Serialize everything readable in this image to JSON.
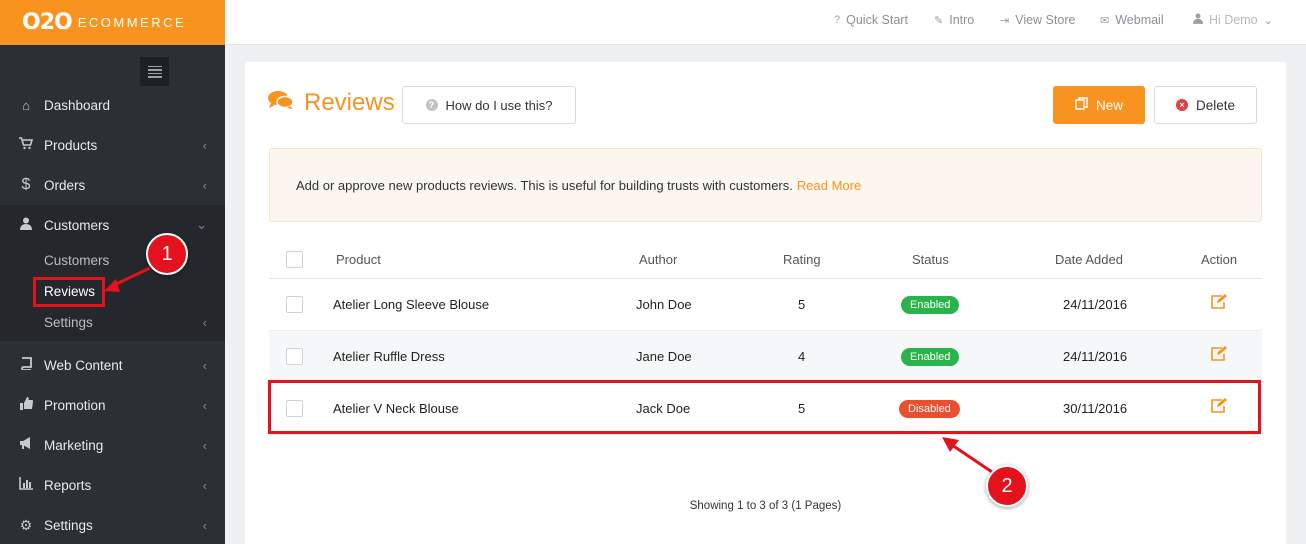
{
  "logo": {
    "mark": "O2O",
    "text": "ECOMMERCE"
  },
  "topbar": {
    "links": [
      {
        "label": "Quick Start",
        "icon": "question-icon"
      },
      {
        "label": "Intro",
        "icon": "magic-wand-icon"
      },
      {
        "label": "View Store",
        "icon": "sign-in-icon"
      },
      {
        "label": "Webmail",
        "icon": "envelope-icon"
      }
    ],
    "user_label": "Hi Demo"
  },
  "sidebar": {
    "items": [
      {
        "label": "Dashboard"
      },
      {
        "label": "Products"
      },
      {
        "label": "Orders"
      },
      {
        "label": "Customers"
      },
      {
        "label": "Web Content"
      },
      {
        "label": "Promotion"
      },
      {
        "label": "Marketing"
      },
      {
        "label": "Reports"
      },
      {
        "label": "Settings"
      }
    ],
    "sub_items": [
      {
        "label": "Customers"
      },
      {
        "label": "Reviews"
      },
      {
        "label": "Settings"
      }
    ]
  },
  "page": {
    "title": "Reviews",
    "help_label": "How do I use this?",
    "new_label": "New",
    "delete_label": "Delete",
    "notice_text": "Add or approve new products reviews. This is useful for building trusts with customers.",
    "notice_link": "Read More"
  },
  "table": {
    "headers": [
      "Product",
      "Author",
      "Rating",
      "Status",
      "Date Added",
      "Action"
    ],
    "rows": [
      {
        "product": "Atelier Long Sleeve Blouse",
        "author": "John Doe",
        "rating": "5",
        "status": "Enabled",
        "date": "24/11/2016"
      },
      {
        "product": "Atelier Ruffle Dress",
        "author": "Jane Doe",
        "rating": "4",
        "status": "Enabled",
        "date": "24/11/2016"
      },
      {
        "product": "Atelier V Neck Blouse",
        "author": "Jack Doe",
        "rating": "5",
        "status": "Disabled",
        "date": "30/11/2016"
      }
    ],
    "footer": "Showing 1 to 3 of 3 (1 Pages)"
  },
  "annotations": {
    "step1": "1",
    "step2": "2"
  },
  "colors": {
    "accent": "#f7931e",
    "enabled": "#29b34a",
    "disabled": "#e8502f",
    "annotation": "#e3121c",
    "sidebar": "#2b3035"
  }
}
